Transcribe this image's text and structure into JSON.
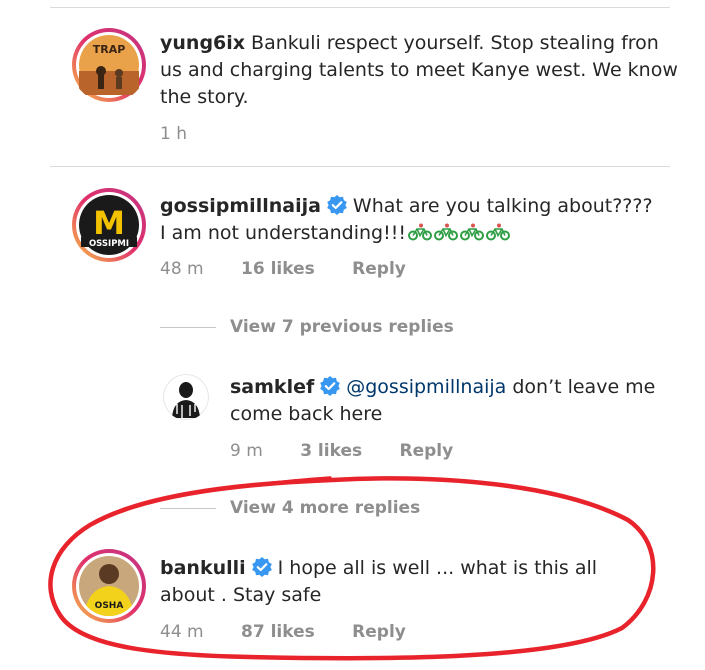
{
  "comments": [
    {
      "username": "yung6ix",
      "text": "Bankuli respect yourself. Stop stealing fron us and charging talents to meet  Kanye west. We know the story.",
      "time": "1 h"
    },
    {
      "username": "gossipmillnaija",
      "verified": true,
      "text": "What are you talking about???? I am not understanding!!!",
      "emoji_count": 4,
      "emoji_name": "bicycle-icon",
      "time": "48 m",
      "likes": "16 likes",
      "reply_label": "Reply",
      "avatar_letter": "M",
      "avatar_text": "OSSIPMI"
    },
    {
      "view_replies": "View 7 previous replies"
    },
    {
      "username": "samklef",
      "verified": true,
      "mention": "@gossipmillnaija",
      "text": " don’t leave me come back here",
      "time": "9 m",
      "likes": "3 likes",
      "reply_label": "Reply"
    },
    {
      "view_replies": "View 4 more replies"
    },
    {
      "username": "bankulli",
      "verified": true,
      "text": "I hope all is well ... what is this all about . Stay safe",
      "time": "44 m",
      "likes": "87 likes",
      "reply_label": "Reply",
      "shirt_text": "OSHA"
    }
  ],
  "colors": {
    "verified_blue": "#3897f0",
    "mention_blue": "#00376b",
    "meta_grey": "#8e8e8e",
    "highlight_red": "#e8232b"
  }
}
